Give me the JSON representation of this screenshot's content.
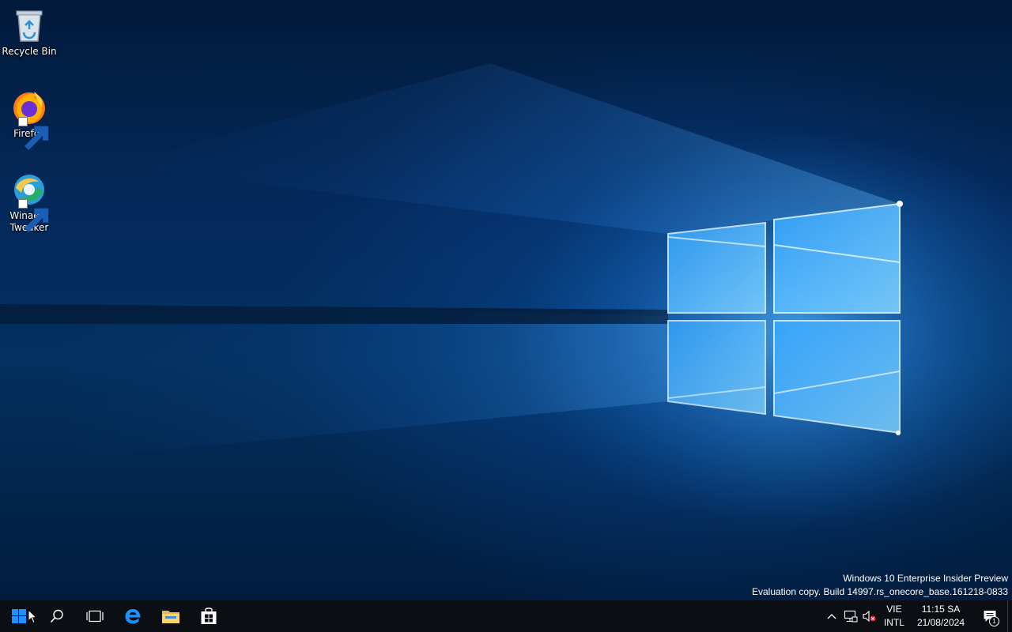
{
  "desktop": {
    "icons": [
      {
        "label": "Recycle Bin",
        "icon": "recycle-bin-icon",
        "shortcut": false
      },
      {
        "label": "Firefox",
        "icon": "firefox-icon",
        "shortcut": true
      },
      {
        "label": "Winaero Tweaker",
        "icon": "winaero-tweaker-icon",
        "shortcut": true
      }
    ],
    "watermark": {
      "line1": "Windows 10 Enterprise Insider Preview",
      "line2": "Evaluation copy. Build 14997.rs_onecore_base.161218-0833"
    }
  },
  "taskbar": {
    "buttons": [
      {
        "name": "start-button",
        "icon": "windows-logo-icon"
      },
      {
        "name": "search-button",
        "icon": "search-icon"
      },
      {
        "name": "task-view-button",
        "icon": "task-view-icon"
      },
      {
        "name": "edge-button",
        "icon": "edge-icon"
      },
      {
        "name": "file-explorer-button",
        "icon": "folder-icon"
      },
      {
        "name": "store-button",
        "icon": "store-icon"
      }
    ],
    "tray": {
      "chevron": "chevron-up-icon",
      "network": "network-icon",
      "volume": "volume-muted-icon",
      "language": {
        "code": "VIE",
        "layout": "INTL"
      },
      "clock": {
        "time": "11:15 SA",
        "date": "21/08/2024"
      },
      "notifications": {
        "icon": "action-center-icon",
        "count": "1"
      }
    }
  },
  "colors": {
    "taskbar": "#0b0f14",
    "accent": "#1e90ff",
    "wallpaper_dark": "#021a3a",
    "wallpaper_glow": "#4fb3ff"
  }
}
